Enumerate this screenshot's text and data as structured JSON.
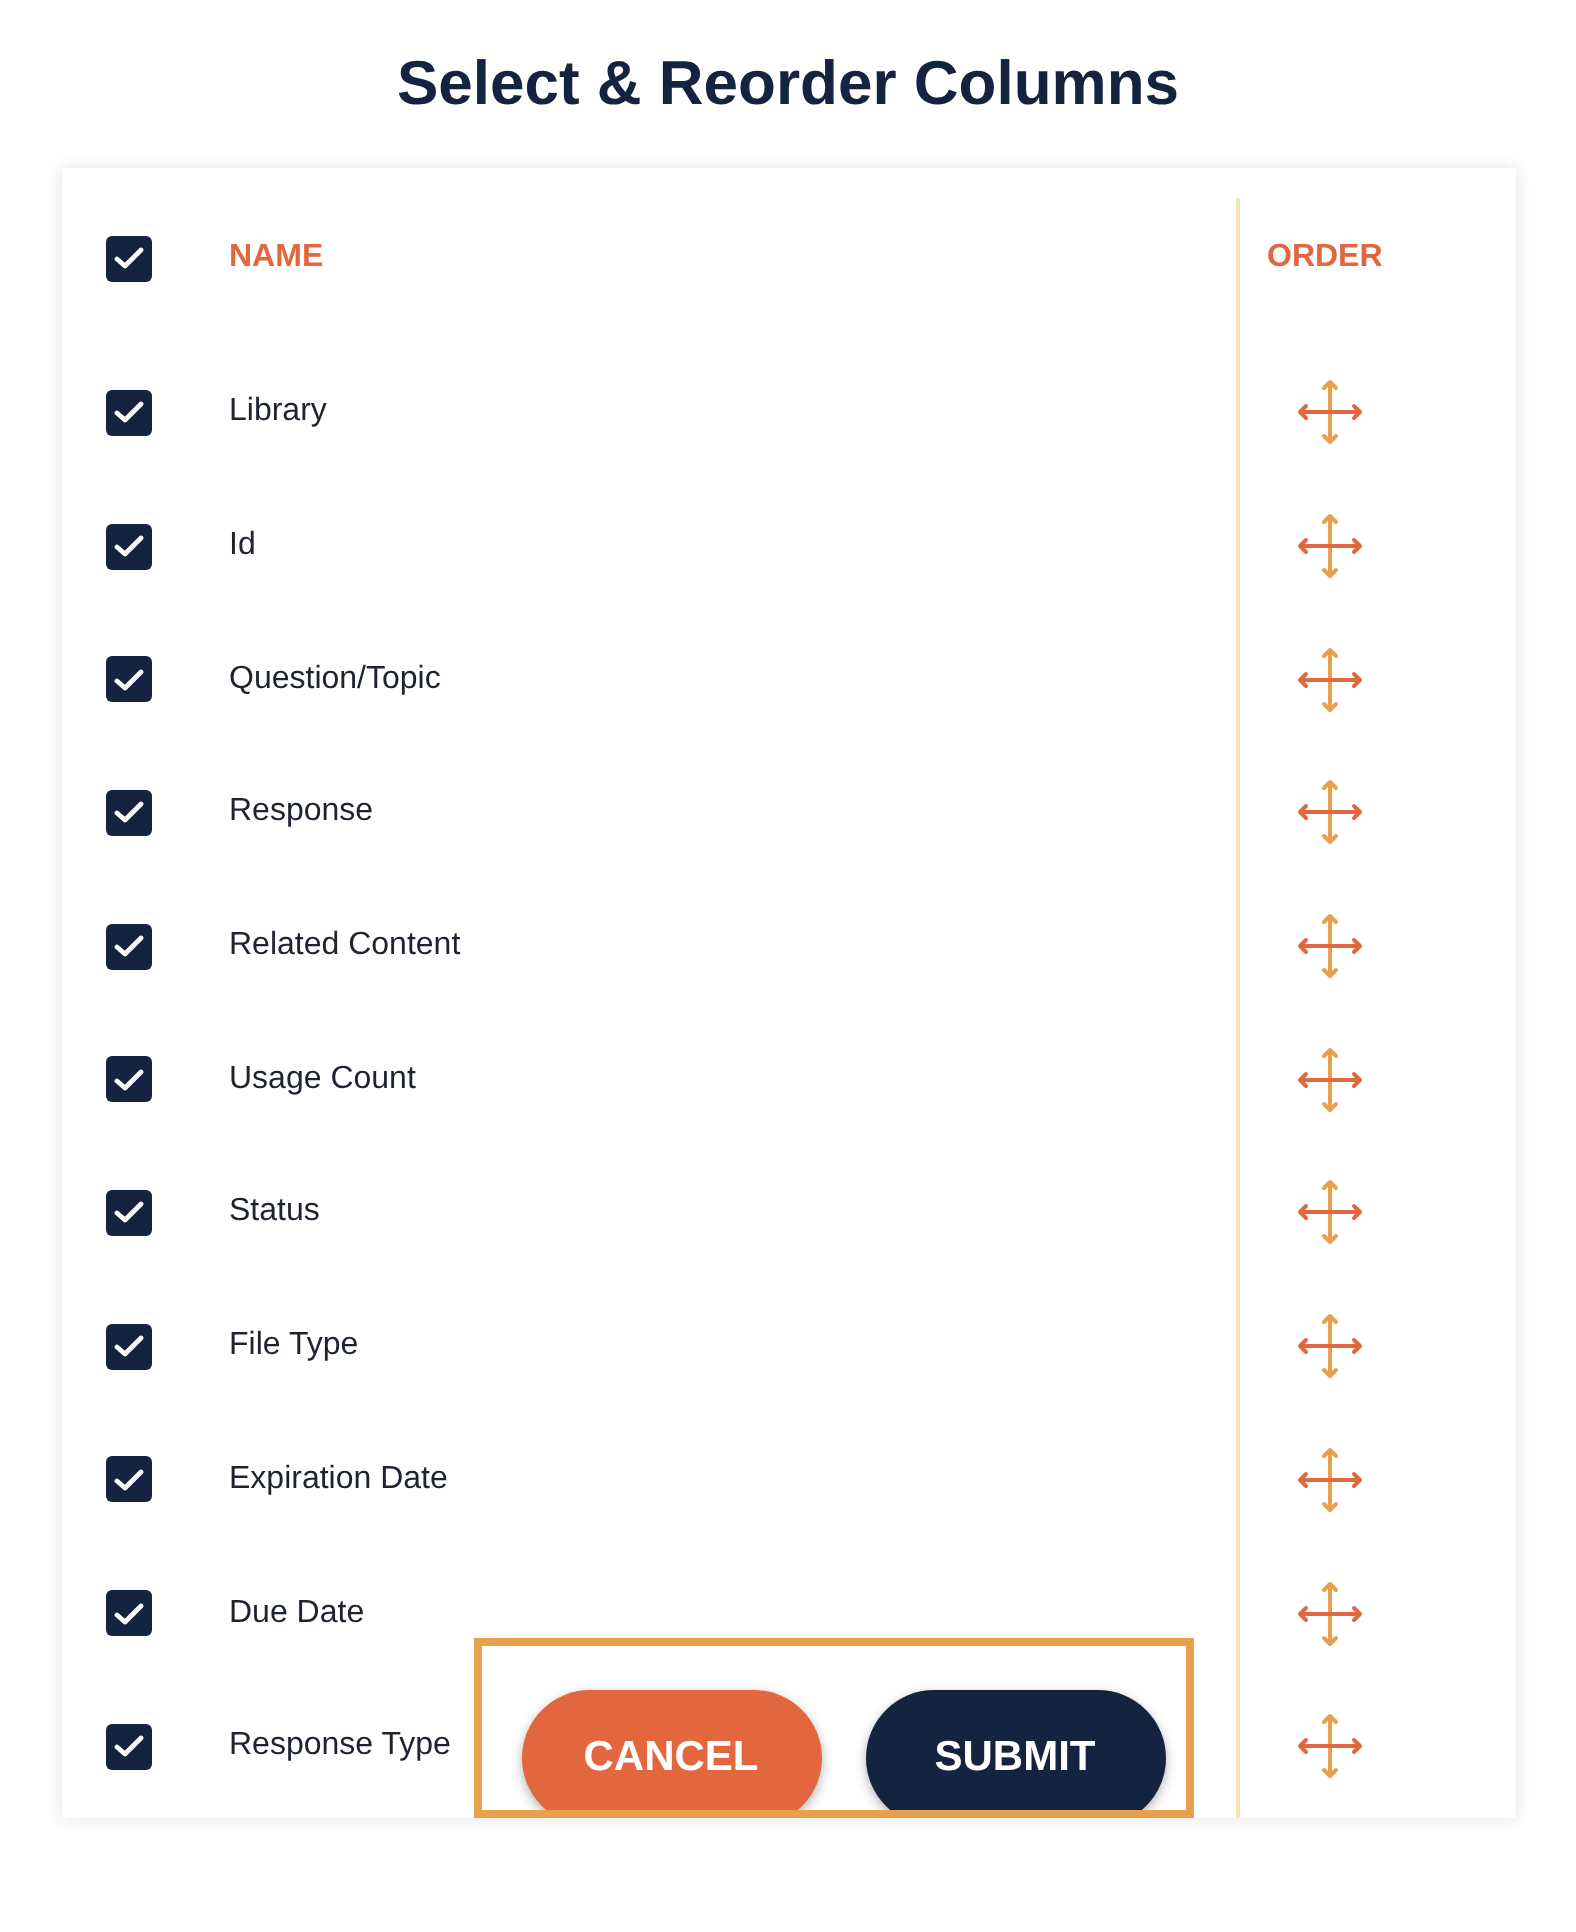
{
  "title": "Select & Reorder Columns",
  "header": {
    "name_label": "NAME",
    "order_label": "ORDER",
    "checked": true
  },
  "rows": [
    {
      "label": "Library",
      "checked": true
    },
    {
      "label": "Id",
      "checked": true
    },
    {
      "label": "Question/Topic",
      "checked": true
    },
    {
      "label": "Response",
      "checked": true
    },
    {
      "label": "Related Content",
      "checked": true
    },
    {
      "label": "Usage Count",
      "checked": true
    },
    {
      "label": "Status",
      "checked": true
    },
    {
      "label": "File Type",
      "checked": true
    },
    {
      "label": "Expiration Date",
      "checked": true
    },
    {
      "label": "Due Date",
      "checked": true
    },
    {
      "label": "Response Type",
      "checked": true
    }
  ],
  "buttons": [
    {
      "label": "CANCEL",
      "kind": "secondary"
    },
    {
      "label": "SUBMIT",
      "kind": "primary"
    }
  ]
}
